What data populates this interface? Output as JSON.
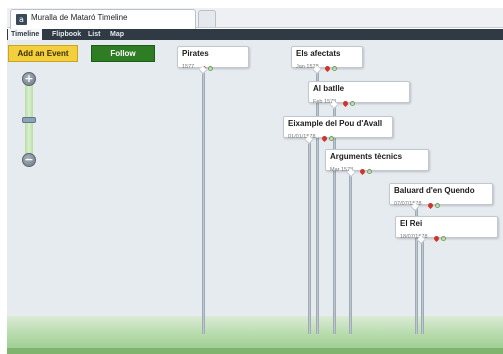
{
  "window": {
    "tab_title": "Muralla de Mataró Timeline",
    "favicon_glyph": "a"
  },
  "nav": {
    "items": [
      "Timeline",
      "Flipbook",
      "List",
      "Map"
    ],
    "active": "Timeline"
  },
  "toolbar": {
    "add_label": "Add an Event",
    "follow_label": "Follow"
  },
  "zoom": {
    "plus_glyph": "+",
    "minus_glyph": "−",
    "level": 0.55
  },
  "events": [
    {
      "title": "Pirates",
      "date": "1577"
    },
    {
      "title": "Els afectats",
      "date": "Jan 1578"
    },
    {
      "title": "Al batlle",
      "date": "Feb 1578"
    },
    {
      "title": "Eixample del Pou d'Avall",
      "date": "01/01/1578"
    },
    {
      "title": "Arguments tècnics",
      "date": "Mar 1578"
    },
    {
      "title": "Baluard d'en Quendo",
      "date": "07/07/1578"
    },
    {
      "title": "El Rei",
      "date": "18/07/1578"
    }
  ],
  "colors": {
    "accent_add": "#f3cf3d",
    "accent_follow": "#2e7d25",
    "nav_bg": "#2f3a45",
    "canvas_bg": "#e6ebf0",
    "pin": "#d0342c"
  }
}
